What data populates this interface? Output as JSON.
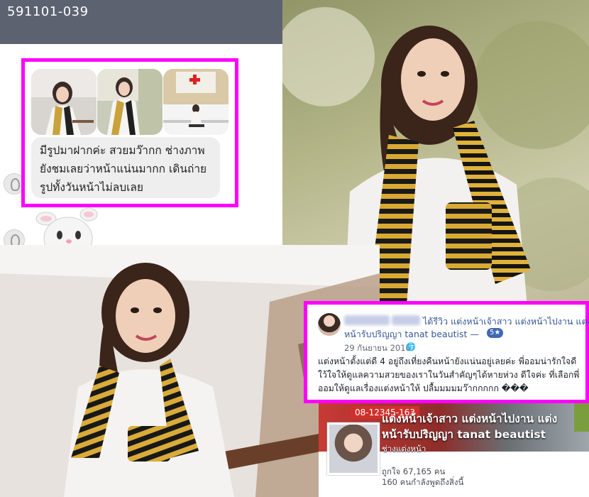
{
  "chat": {
    "title": "591101-039",
    "message": "มีรูปมาฝากค่ะ สวยมว๊ากก ช่างภาพ\nยังชมเลยว่าหน้าแน่นมากก เดินถ่าย\nรูปทั้งวันหน้าไม่ลบเลย",
    "thumbnails": [
      "graduate-photo-1",
      "graduate-photo-2",
      "graduate-photo-3"
    ]
  },
  "review": {
    "action_text": "ได้รีวิว แต่งหน้าเจ้าสาว แต่งหน้าไปงาน แต่ง",
    "page_name_line": "หน้ารับปริญญา tanat beautist —",
    "rating_badge": "5★",
    "date": "29 กันยายน 2016 ·",
    "globe_icon": "globe-icon",
    "text": "แต่งหน้าตั้งแต่ดี 4 อยู่ถึงเที่ยงคืนหน้ายังแน่นอยู่เลยค่ะ พี่ออมน่ารักใจดี\nใว้ใจให้ดูแลความสวยของเราในวันสำคัญๆได้หายห่วง ดีใจค่ะ ที่เลือกพี่\nออมให้ดูแลเรื่องแต่งหน้าให้ ปลื้มมมมมว๊ากกกกก ���"
  },
  "page_card": {
    "phone": "08-12345-163",
    "title": "แต่งหน้าเจ้าสาว แต่งหน้าไปงาน แต่ง\nหน้ารับปริญญา tanat beautist",
    "category": "ช่างแต่งหน้า",
    "likes": "ถูกใจ 67,165 คน",
    "checkins": "160 คนกำลังพูดถึงสิ่งนี้"
  },
  "colors": {
    "highlight": "#ff00ff",
    "chat_header": "#5d6271",
    "bubble": "#eeeeee",
    "facebook_link": "#365899"
  }
}
